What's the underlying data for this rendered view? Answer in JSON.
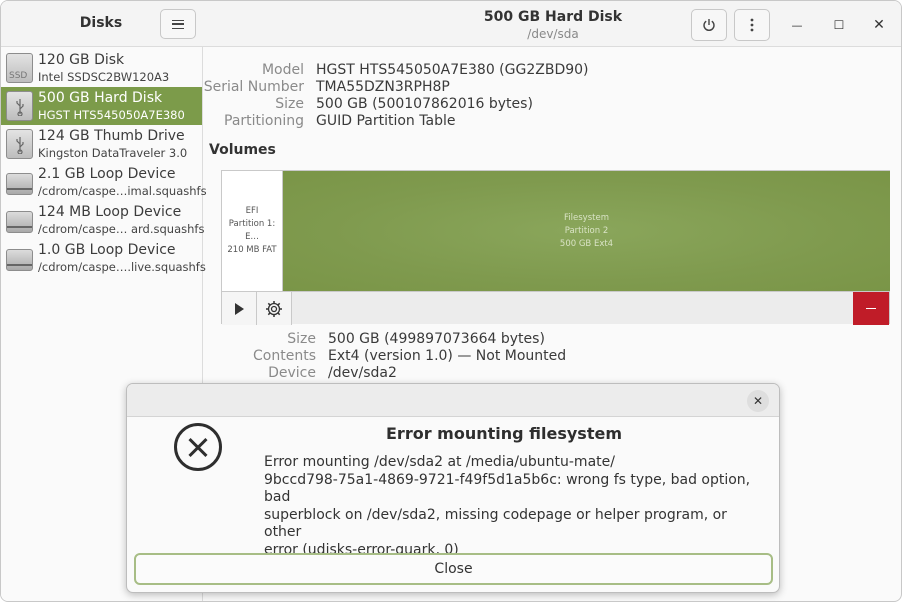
{
  "sidebar": {
    "title": "Disks",
    "disks": [
      {
        "name": "120 GB Disk",
        "sub": "Intel SSDSC2BW120A3",
        "icon": "ssd-icon",
        "selected": false
      },
      {
        "name": "500 GB Hard Disk",
        "sub": "HGST HTS545050A7E380",
        "icon": "usb-drive-icon",
        "selected": true
      },
      {
        "name": "124 GB Thumb Drive",
        "sub": "Kingston DataTraveler 3.0",
        "icon": "usb-drive-icon",
        "selected": false
      },
      {
        "name": "2.1 GB Loop Device",
        "sub": "/cdrom/caspe…imal.squashfs",
        "icon": "loop-device-icon",
        "selected": false
      },
      {
        "name": "124 MB Loop Device",
        "sub": "/cdrom/caspe… ard.squashfs",
        "icon": "loop-device-icon",
        "selected": false
      },
      {
        "name": "1.0 GB Loop Device",
        "sub": "/cdrom/caspe….live.squashfs",
        "icon": "loop-device-icon",
        "selected": false
      }
    ]
  },
  "header": {
    "title": "500 GB Hard Disk",
    "subtitle": "/dev/sda"
  },
  "drive_info": {
    "model_label": "Model",
    "model": "HGST HTS545050A7E380 (GG2ZBD90)",
    "serial_label": "Serial Number",
    "serial": "TMA55DZN3RPH8P",
    "size_label": "Size",
    "size": "500 GB (500107862016 bytes)",
    "partitioning_label": "Partitioning",
    "partitioning": "GUID Partition Table"
  },
  "volumes": {
    "title": "Volumes",
    "efi": {
      "line1": "EFI",
      "line2": "Partition 1: E…",
      "line3": "210 MB FAT"
    },
    "filesystem": {
      "line1": "Filesystem",
      "line2": "Partition 2",
      "line3": "500 GB Ext4"
    }
  },
  "partition_info": {
    "size_label": "Size",
    "size": "500 GB (499897073664 bytes)",
    "contents_label": "Contents",
    "contents": "Ext4 (version 1.0) — Not Mounted",
    "device_label": "Device",
    "device": "/dev/sda2"
  },
  "dialog": {
    "title": "Error mounting filesystem",
    "message": "Error mounting /dev/sda2 at /media/ubuntu-mate/\n9bccd798-75a1-4869-9721-f49f5d1a5b6c: wrong fs type, bad option, bad\nsuperblock on /dev/sda2, missing codepage or helper program, or other\nerror (udisks-error-quark, 0)",
    "close_label": "Close",
    "close_icon": "✕"
  },
  "window_controls": {
    "minimize": "—",
    "maximize": "☐",
    "close": "✕"
  },
  "colors": {
    "accent": "#7c9b4a",
    "danger": "#c01c28"
  }
}
